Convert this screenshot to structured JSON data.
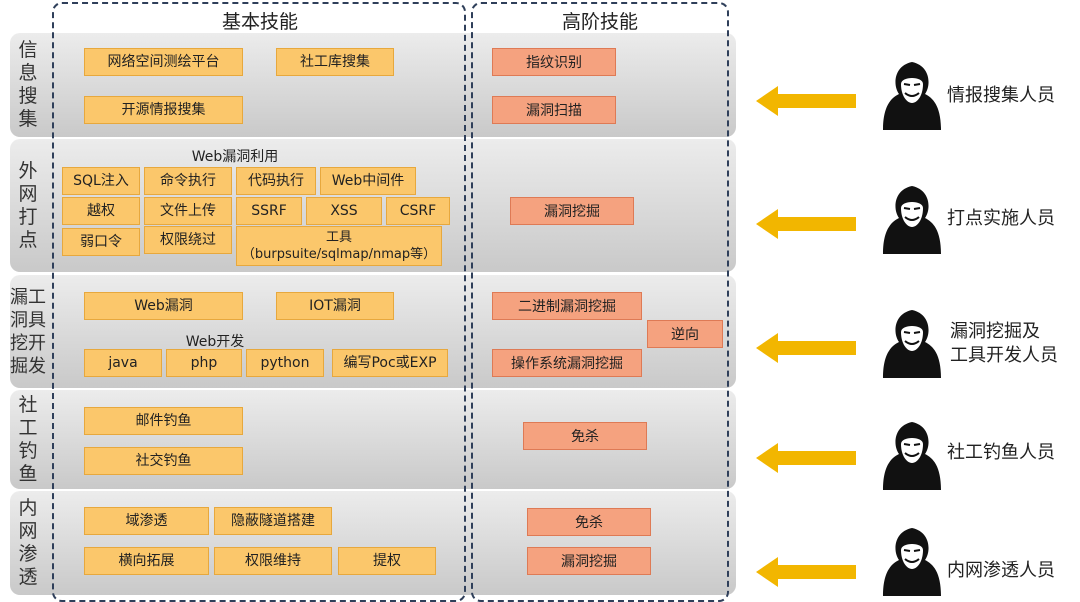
{
  "columns": {
    "basic": "基本技能",
    "advanced": "高阶技能"
  },
  "rows": [
    {
      "label": "信\n息\n搜\n集",
      "basic": [
        "网络空间测绘平台",
        "社工库搜集",
        "开源情报搜集"
      ],
      "advanced": [
        "指纹识别",
        "漏洞扫描"
      ],
      "role": "情报搜集人员"
    },
    {
      "label": "外\n网\n打\n点",
      "subtitle": "Web漏洞利用",
      "basic": [
        "SQL注入",
        "命令执行",
        "代码执行",
        "Web中间件",
        "越权",
        "文件上传",
        "SSRF",
        "XSS",
        "CSRF",
        "弱口令",
        "权限绕过",
        "工具\n（burpsuite/sqlmap/nmap等）"
      ],
      "advanced": [
        "漏洞挖掘"
      ],
      "role": "打点实施人员"
    },
    {
      "label": "漏工\n洞具\n挖开\n掘发",
      "subtitle": "Web开发",
      "basic": [
        "Web漏洞",
        "IOT漏洞",
        "java",
        "php",
        "python",
        "编写Poc或EXP"
      ],
      "advanced": [
        "二进制漏洞挖掘",
        "逆向",
        "操作系统漏洞挖掘"
      ],
      "role": "漏洞挖掘及\n工具开发人员"
    },
    {
      "label": "社\n工\n钓\n鱼",
      "basic": [
        "邮件钓鱼",
        "社交钓鱼"
      ],
      "advanced": [
        "免杀"
      ],
      "role": "社工钓鱼人员"
    },
    {
      "label": "内\n网\n渗\n透",
      "basic": [
        "域渗透",
        "隐蔽隧道搭建",
        "横向拓展",
        "权限维持",
        "提权"
      ],
      "advanced": [
        "免杀",
        "漏洞挖掘"
      ],
      "role": "内网渗透人员"
    }
  ],
  "colors": {
    "basic_box": "#fbc76b",
    "advanced_box": "#f5a27f",
    "arrow": "#f2b600",
    "row_bg": "#d9d9d9",
    "dash": "#2f3f5a"
  },
  "icons": {
    "role": "anonymous-hacker-icon",
    "pointer": "left-arrow-icon"
  }
}
